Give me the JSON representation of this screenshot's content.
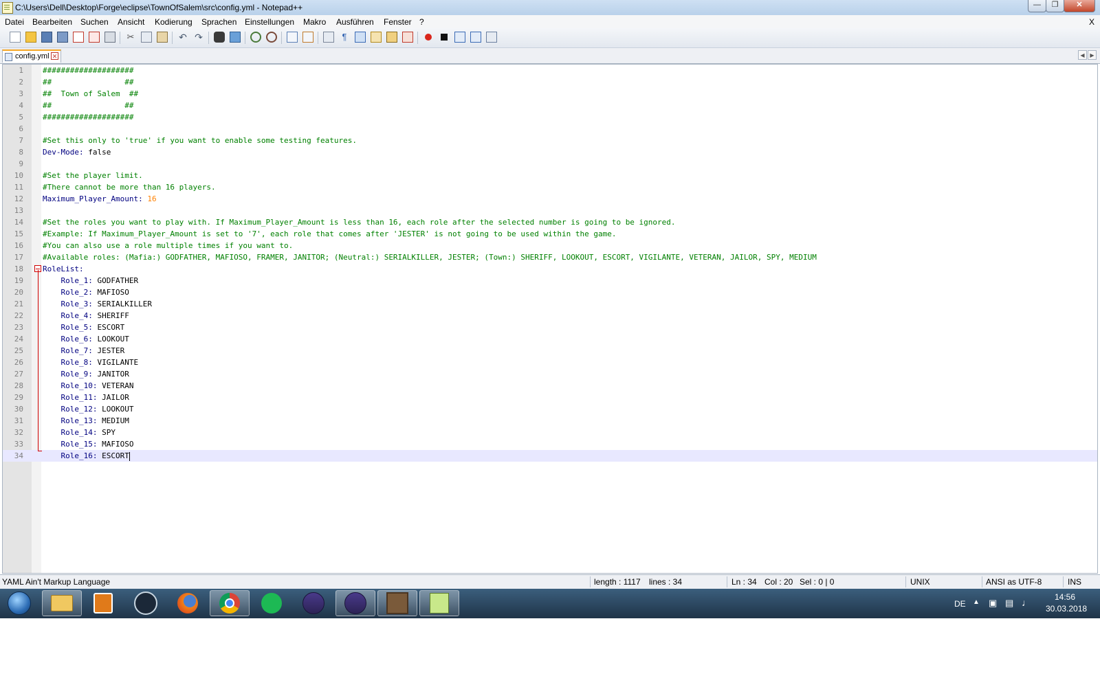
{
  "window": {
    "title": "C:\\Users\\Dell\\Desktop\\Forge\\eclipse\\TownOfSalem\\src\\config.yml - Notepad++"
  },
  "menu": {
    "items": [
      "Datei",
      "Bearbeiten",
      "Suchen",
      "Ansicht",
      "Kodierung",
      "Sprachen",
      "Einstellungen",
      "Makro",
      "Ausführen",
      "Fenster",
      "?"
    ],
    "close": "X"
  },
  "toolbar": {
    "icons": [
      "new-file-icon",
      "open-file-icon",
      "save-icon",
      "save-all-icon",
      "close-icon",
      "close-all-icon",
      "print-icon",
      "cut-icon",
      "copy-icon",
      "paste-icon",
      "undo-icon",
      "redo-icon",
      "find-icon",
      "replace-icon",
      "zoom-in-icon",
      "zoom-out-icon",
      "sync-vertical-icon",
      "sync-horizontal-icon",
      "word-wrap-icon",
      "show-all-chars-icon",
      "indent-guide-icon",
      "user-lang-icon",
      "doc-map-icon",
      "function-list-icon",
      "record-macro-icon",
      "stop-macro-icon",
      "play-macro-icon",
      "run-macro-multiple-icon",
      "save-macro-icon"
    ]
  },
  "tab": {
    "label": "config.yml"
  },
  "editor": {
    "lines": [
      [
        {
          "t": "####################",
          "c": "cm"
        }
      ],
      [
        {
          "t": "##                ##",
          "c": "cm"
        }
      ],
      [
        {
          "t": "##  Town of Salem  ##",
          "c": "cm"
        }
      ],
      [
        {
          "t": "##                ##",
          "c": "cm"
        }
      ],
      [
        {
          "t": "####################",
          "c": "cm"
        }
      ],
      [],
      [
        {
          "t": "#Set this only to 'true' if you want to enable some testing features.",
          "c": "cm"
        }
      ],
      [
        {
          "t": "Dev-Mode:",
          "c": "ky"
        },
        {
          "t": " false",
          "c": "vl"
        }
      ],
      [],
      [
        {
          "t": "#Set the player limit.",
          "c": "cm"
        }
      ],
      [
        {
          "t": "#There cannot be more than 16 players.",
          "c": "cm"
        }
      ],
      [
        {
          "t": "Maximum_Player_Amount:",
          "c": "ky"
        },
        {
          "t": " 16",
          "c": "nm"
        }
      ],
      [],
      [
        {
          "t": "#Set the roles you want to play with. If Maximum_Player_Amount is less than 16, each role after the selected number is going to be ignored.",
          "c": "cm"
        }
      ],
      [
        {
          "t": "#Example: If Maximum_Player_Amount is set to '7', each role that comes after 'JESTER' is not going to be used within the game.",
          "c": "cm"
        }
      ],
      [
        {
          "t": "#You can also use a role multiple times if you want to.",
          "c": "cm"
        }
      ],
      [
        {
          "t": "#Available roles: (Mafia:) GODFATHER, MAFIOSO, FRAMER, JANITOR; (Neutral:) SERIALKILLER, JESTER; (Town:) SHERIFF, LOOKOUT, ESCORT, VIGILANTE, VETERAN, JAILOR, SPY, MEDIUM",
          "c": "cm"
        }
      ],
      [
        {
          "t": "RoleList:",
          "c": "ky"
        }
      ],
      [
        {
          "t": "    Role_1:",
          "c": "ky"
        },
        {
          "t": " GODFATHER",
          "c": "vl"
        }
      ],
      [
        {
          "t": "    Role_2:",
          "c": "ky"
        },
        {
          "t": " MAFIOSO",
          "c": "vl"
        }
      ],
      [
        {
          "t": "    Role_3:",
          "c": "ky"
        },
        {
          "t": " SERIALKILLER",
          "c": "vl"
        }
      ],
      [
        {
          "t": "    Role_4:",
          "c": "ky"
        },
        {
          "t": " SHERIFF",
          "c": "vl"
        }
      ],
      [
        {
          "t": "    Role_5:",
          "c": "ky"
        },
        {
          "t": " ESCORT",
          "c": "vl"
        }
      ],
      [
        {
          "t": "    Role_6:",
          "c": "ky"
        },
        {
          "t": " LOOKOUT",
          "c": "vl"
        }
      ],
      [
        {
          "t": "    Role_7:",
          "c": "ky"
        },
        {
          "t": " JESTER",
          "c": "vl"
        }
      ],
      [
        {
          "t": "    Role_8:",
          "c": "ky"
        },
        {
          "t": " VIGILANTE",
          "c": "vl"
        }
      ],
      [
        {
          "t": "    Role_9:",
          "c": "ky"
        },
        {
          "t": " JANITOR",
          "c": "vl"
        }
      ],
      [
        {
          "t": "    Role_10:",
          "c": "ky"
        },
        {
          "t": " VETERAN",
          "c": "vl"
        }
      ],
      [
        {
          "t": "    Role_11:",
          "c": "ky"
        },
        {
          "t": " JAILOR",
          "c": "vl"
        }
      ],
      [
        {
          "t": "    Role_12:",
          "c": "ky"
        },
        {
          "t": " LOOKOUT",
          "c": "vl"
        }
      ],
      [
        {
          "t": "    Role_13:",
          "c": "ky"
        },
        {
          "t": " MEDIUM",
          "c": "vl"
        }
      ],
      [
        {
          "t": "    Role_14:",
          "c": "ky"
        },
        {
          "t": " SPY",
          "c": "vl"
        }
      ],
      [
        {
          "t": "    Role_15:",
          "c": "ky"
        },
        {
          "t": " MAFIOSO",
          "c": "vl"
        }
      ],
      [
        {
          "t": "    Role_16:",
          "c": "ky"
        },
        {
          "t": " ESCORT",
          "c": "vl"
        }
      ]
    ],
    "current_line": 34,
    "colors": {
      "comment": "#008000",
      "key": "#000080",
      "number": "#ff8000",
      "fold": "#d00000",
      "current_line_bg": "#e8e8ff"
    }
  },
  "statusbar": {
    "language": "YAML Ain't Markup Language",
    "length": "length : 1117",
    "lines": "lines : 34",
    "ln": "Ln : 34",
    "col": "Col : 20",
    "sel": "Sel : 0 | 0",
    "eol": "UNIX",
    "encoding": "ANSI as UTF-8",
    "mode": "INS"
  },
  "taskbar": {
    "apps": [
      "start-orb-icon",
      "file-explorer-icon",
      "media-player-icon",
      "steam-icon",
      "firefox-icon",
      "chrome-icon",
      "spotify-icon",
      "eclipse-icon",
      "eclipse-icon",
      "minecraft-icon",
      "notepadpp-icon"
    ],
    "language": "DE",
    "time": "14:56",
    "date": "30.03.2018"
  }
}
